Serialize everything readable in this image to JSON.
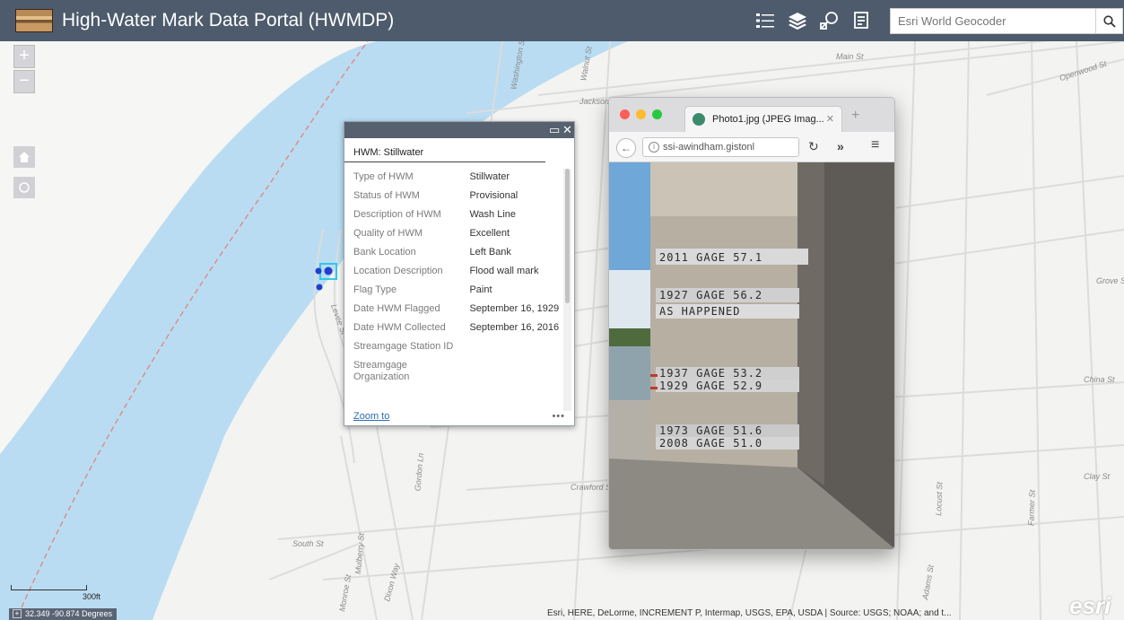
{
  "header": {
    "title": "High-Water Mark Data Portal (HWMDP)",
    "search_placeholder": "Esri World Geocoder"
  },
  "map": {
    "streets": [
      {
        "name": "Main St"
      },
      {
        "name": "Openwood St"
      },
      {
        "name": "Jackson St"
      },
      {
        "name": "Walnut St"
      },
      {
        "name": "Washington St"
      },
      {
        "name": "Grove St"
      },
      {
        "name": "China St"
      },
      {
        "name": "Clay St"
      },
      {
        "name": "Crawford St"
      },
      {
        "name": "South St"
      },
      {
        "name": "Mulberry St"
      },
      {
        "name": "Gordon Ln"
      },
      {
        "name": "Levee St"
      },
      {
        "name": "Locust St"
      },
      {
        "name": "Farmer St"
      },
      {
        "name": "Adams St"
      },
      {
        "name": "Dixon Way"
      },
      {
        "name": "Monroe St"
      }
    ],
    "scale_label": "300ft",
    "coordinates": "32.349 -90.874 Degrees",
    "attribution": "Esri, HERE, DeLorme, INCREMENT P, Intermap, USGS, EPA, USDA | Source: USGS; NOAA; and t...",
    "esri_logo": "esri"
  },
  "popup": {
    "title": "HWM: Stillwater",
    "rows": [
      {
        "label": "Type of HWM",
        "value": "Stillwater"
      },
      {
        "label": "Status of HWM",
        "value": "Provisional"
      },
      {
        "label": "Description of HWM",
        "value": "Wash Line"
      },
      {
        "label": "Quality of HWM",
        "value": "Excellent"
      },
      {
        "label": "Bank Location",
        "value": "Left Bank"
      },
      {
        "label": "Location Description",
        "value": "Flood wall mark"
      },
      {
        "label": "Flag Type",
        "value": "Paint"
      },
      {
        "label": "Date HWM Flagged",
        "value": "September 16, 1929"
      },
      {
        "label": "Date HWM Collected",
        "value": "September 16, 2016"
      },
      {
        "label": "Streamgage Station ID",
        "value": ""
      },
      {
        "label": "Streamgage Organization",
        "value": ""
      }
    ],
    "zoom_link": "Zoom to",
    "more": "•••"
  },
  "browser": {
    "tab_title": "Photo1.jpg (JPEG Imag...",
    "url": "ssi-awindham.gistonl",
    "photo_labels": [
      "2011 GAGE 57.1",
      "1927 GAGE 56.2",
      "AS HAPPENED",
      "1937 GAGE 53.2",
      "1929 GAGE 52.9",
      "1973 GAGE 51.6",
      "2008 GAGE 51.0"
    ]
  },
  "colors": {
    "header_bg": "#4d5b6c",
    "river": "#b9dcf2",
    "popup_bar": "#56606f",
    "link": "#2a6cb0",
    "marker": "#1f3fd0",
    "selection": "#30c8e8"
  }
}
